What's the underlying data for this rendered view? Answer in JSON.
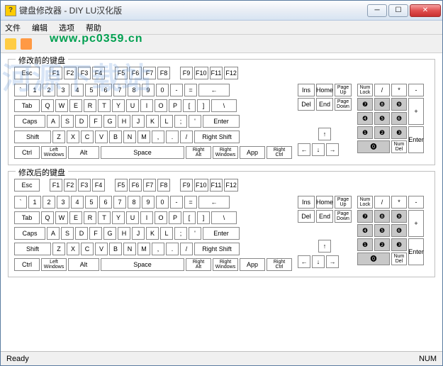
{
  "window": {
    "title": "键盘修改器 - DIY   LU汉化版"
  },
  "menu": {
    "file": "文件",
    "edit": "编辑",
    "options": "选项",
    "help": "帮助"
  },
  "watermark": "www.pc0359.cn",
  "bg_watermark": "河源下载站",
  "group1": {
    "title": "修改前的键盘"
  },
  "group2": {
    "title": "修改后的键盘"
  },
  "keys": {
    "esc": "Esc",
    "fn": [
      "F1",
      "F2",
      "F3",
      "F4",
      "F5",
      "F6",
      "F7",
      "F8",
      "F9",
      "F10",
      "F11",
      "F12"
    ],
    "row1": [
      "`",
      "1",
      "2",
      "3",
      "4",
      "5",
      "6",
      "7",
      "8",
      "9",
      "0",
      "-",
      "="
    ],
    "backspace": "←",
    "tab": "Tab",
    "row2": [
      "Q",
      "W",
      "E",
      "R",
      "T",
      "Y",
      "U",
      "I",
      "O",
      "P",
      "[",
      "]"
    ],
    "backslash": "\\",
    "caps": "Caps",
    "row3": [
      "A",
      "S",
      "D",
      "F",
      "G",
      "H",
      "J",
      "K",
      "L",
      ";",
      "'"
    ],
    "enter": "Enter",
    "shift": "Shift",
    "row4": [
      "Z",
      "X",
      "C",
      "V",
      "B",
      "N",
      "M",
      ",",
      ".",
      "/"
    ],
    "rshift": "Right Shift",
    "ctrl": "Ctrl",
    "lwin": "Left\nWindows",
    "alt": "Alt",
    "space": "Space",
    "ralt": "Right\nAlt",
    "rwin": "Right\nWindows",
    "app": "App",
    "rctrl": "Right\nCtrl",
    "nav": {
      "ins": "Ins",
      "home": "Home",
      "pgup": "Page\nUp",
      "del": "Del",
      "end": "End",
      "pgdn": "Page\nDown"
    },
    "arrows": {
      "up": "↑",
      "left": "←",
      "down": "↓",
      "right": "→"
    },
    "numpad": {
      "numlock": "Num\nLock",
      "div": "/",
      "mul": "*",
      "sub": "-",
      "7": "❼",
      "8": "❽",
      "9": "❾",
      "add": "+",
      "4": "❹",
      "5": "❺",
      "6": "❻",
      "1": "❶",
      "2": "❷",
      "3": "❸",
      "enter": "Enter",
      "0": "⓿",
      "dec": "Num\nDel"
    }
  },
  "status": {
    "ready": "Ready",
    "num": "NUM"
  }
}
